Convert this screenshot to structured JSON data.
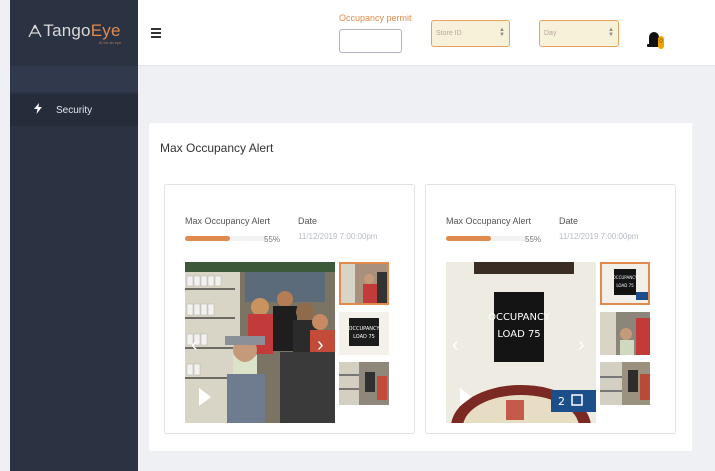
{
  "app": {
    "logo_prefix": "Tango",
    "logo_suffix": "Eye",
    "logo_tagline": "AI for an eye",
    "colors": {
      "accent": "#e08a4e",
      "sidebar": "#2b3242",
      "badge": "#f0a400"
    }
  },
  "sidebar": {
    "items": [
      {
        "label": "Security",
        "icon": "bolt-icon"
      }
    ]
  },
  "header": {
    "menu_icon": "hamburger-icon",
    "occupancy_label": "Occupancy permit",
    "occupancy_value": "",
    "store_select": "Store ID",
    "day_select": "Day",
    "notifications_icon": "bell-icon",
    "notifications_count": "0"
  },
  "panel": {
    "title": "Max Occupancy Alert",
    "cards": [
      {
        "label": "Max Occupancy Alert",
        "date_label": "Date",
        "date": "11/12/2019 7:00:00pm",
        "percent": 55,
        "percent_text": "55%",
        "sign_line1": "OCCUPANCY",
        "sign_line2": "LOAD 75"
      },
      {
        "label": "Max Occupancy Alert",
        "date_label": "Date",
        "date": "11/12/2019 7:00:00pm",
        "percent": 55,
        "percent_text": "55%",
        "sign_line1": "OCCUPANCY",
        "sign_line2": "LOAD 75",
        "overlay_badge": "2",
        "thumb_sign_line1": "OCCUPANCY",
        "thumb_sign_line2": "LOAD 75"
      }
    ]
  }
}
